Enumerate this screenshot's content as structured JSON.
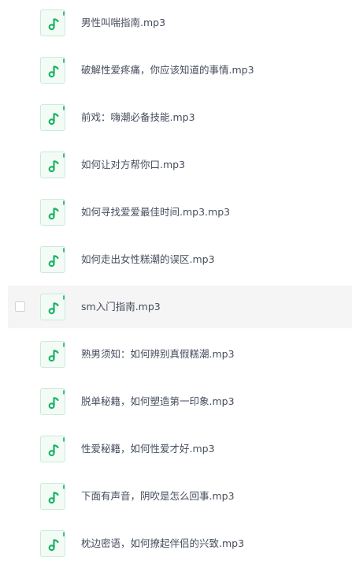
{
  "accent_color": "#19b364",
  "file_icon_name": "music-note-file-icon",
  "files": [
    {
      "name": "男性叫喘指南.mp3"
    },
    {
      "name": "破解性爱疼痛，你应该知道的事情.mp3"
    },
    {
      "name": "前戏：嗨潮必备技能.mp3"
    },
    {
      "name": "如何让对方帮你口.mp3"
    },
    {
      "name": "如何寻找爱爱最佳时间.mp3.mp3"
    },
    {
      "name": "如何走出女性糕潮的误区.mp3"
    },
    {
      "name": "sm入门指南.mp3",
      "hovered": true
    },
    {
      "name": "熟男须知：如何辨别真假糕潮.mp3"
    },
    {
      "name": "脱单秘籍，如何塑造第一印象.mp3"
    },
    {
      "name": "性爱秘籍，如何性爱才好.mp3"
    },
    {
      "name": "下面有声音，阴吹是怎么回事.mp3"
    },
    {
      "name": "枕边密语，如何撩起伴侣的兴致.mp3"
    }
  ]
}
